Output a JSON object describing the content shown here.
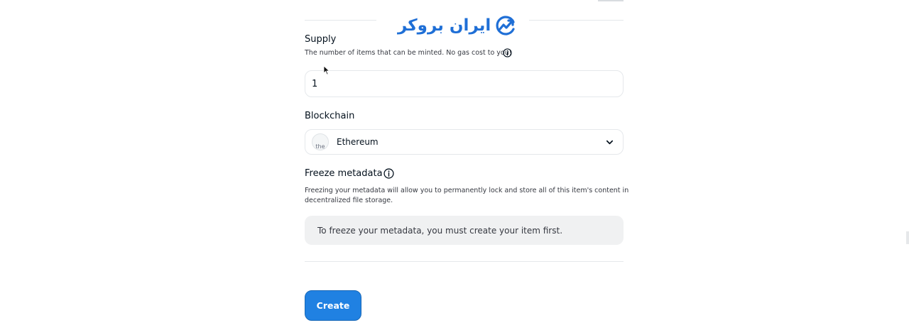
{
  "watermark": {
    "text": "ایران بروکر",
    "color": "#1f6fd6",
    "icon": "trend-up-circle-logo"
  },
  "supply": {
    "label": "Supply",
    "help": "The number of items that can be minted. No gas cost to you!",
    "value": "1",
    "info_icon": "info-circle-icon"
  },
  "blockchain": {
    "label": "Blockchain",
    "selected": "Ethereum",
    "icon_alt": "the",
    "chevron_icon": "chevron-down-icon"
  },
  "freeze": {
    "label": "Freeze metadata",
    "help_line1": "Freezing your metadata will allow you to permanently lock and store all of this item's content in",
    "help_line2": "decentralized file storage.",
    "notice": "To freeze your metadata, you must create your item first.",
    "info_icon": "info-circle-icon"
  },
  "actions": {
    "create_label": "Create",
    "primary_color": "#2081e2"
  }
}
